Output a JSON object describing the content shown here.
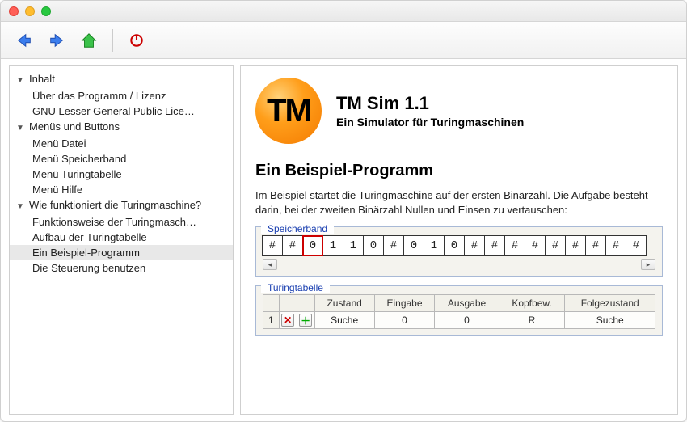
{
  "sidebar": {
    "groups": [
      {
        "label": "Inhalt",
        "items": [
          "Über das Programm / Lizenz",
          "GNU Lesser General Public Lice…"
        ]
      },
      {
        "label": "Menüs und Buttons",
        "items": [
          "Menü Datei",
          "Menü Speicherband",
          "Menü Turingtabelle",
          "Menü Hilfe"
        ]
      },
      {
        "label": "Wie funktioniert die Turingmaschine?",
        "items": [
          "Funktionsweise der Turingmasch…",
          "Aufbau der Turingtabelle",
          "Ein Beispiel-Programm",
          "Die Steuerung benutzen"
        ]
      }
    ],
    "selected": "Ein Beispiel-Programm"
  },
  "hero": {
    "logo_text": "TM",
    "title": "TM Sim 1.1",
    "subtitle": "Ein Simulator für Turingmaschinen"
  },
  "heading": "Ein Beispiel-Programm",
  "paragraph": "Im Beispiel startet die Turingmaschine auf der ersten Binärzahl. Die Aufgabe besteht darin, bei der zweiten Binärzahl Nullen und Einsen zu vertauschen:",
  "tape": {
    "title": "Speicherband",
    "head_index": 2,
    "cells": [
      "#",
      "#",
      "0",
      "1",
      "1",
      "0",
      "#",
      "0",
      "1",
      "0",
      "#",
      "#",
      "#",
      "#",
      "#",
      "#",
      "#",
      "#",
      "#"
    ]
  },
  "table": {
    "title": "Turingtabelle",
    "headers": [
      "Zustand",
      "Eingabe",
      "Ausgabe",
      "Kopfbew.",
      "Folgezustand"
    ],
    "rows": [
      {
        "n": "1",
        "zustand": "Suche",
        "eingabe": "0",
        "ausgabe": "0",
        "kopf": "R",
        "folge": "Suche"
      }
    ]
  }
}
